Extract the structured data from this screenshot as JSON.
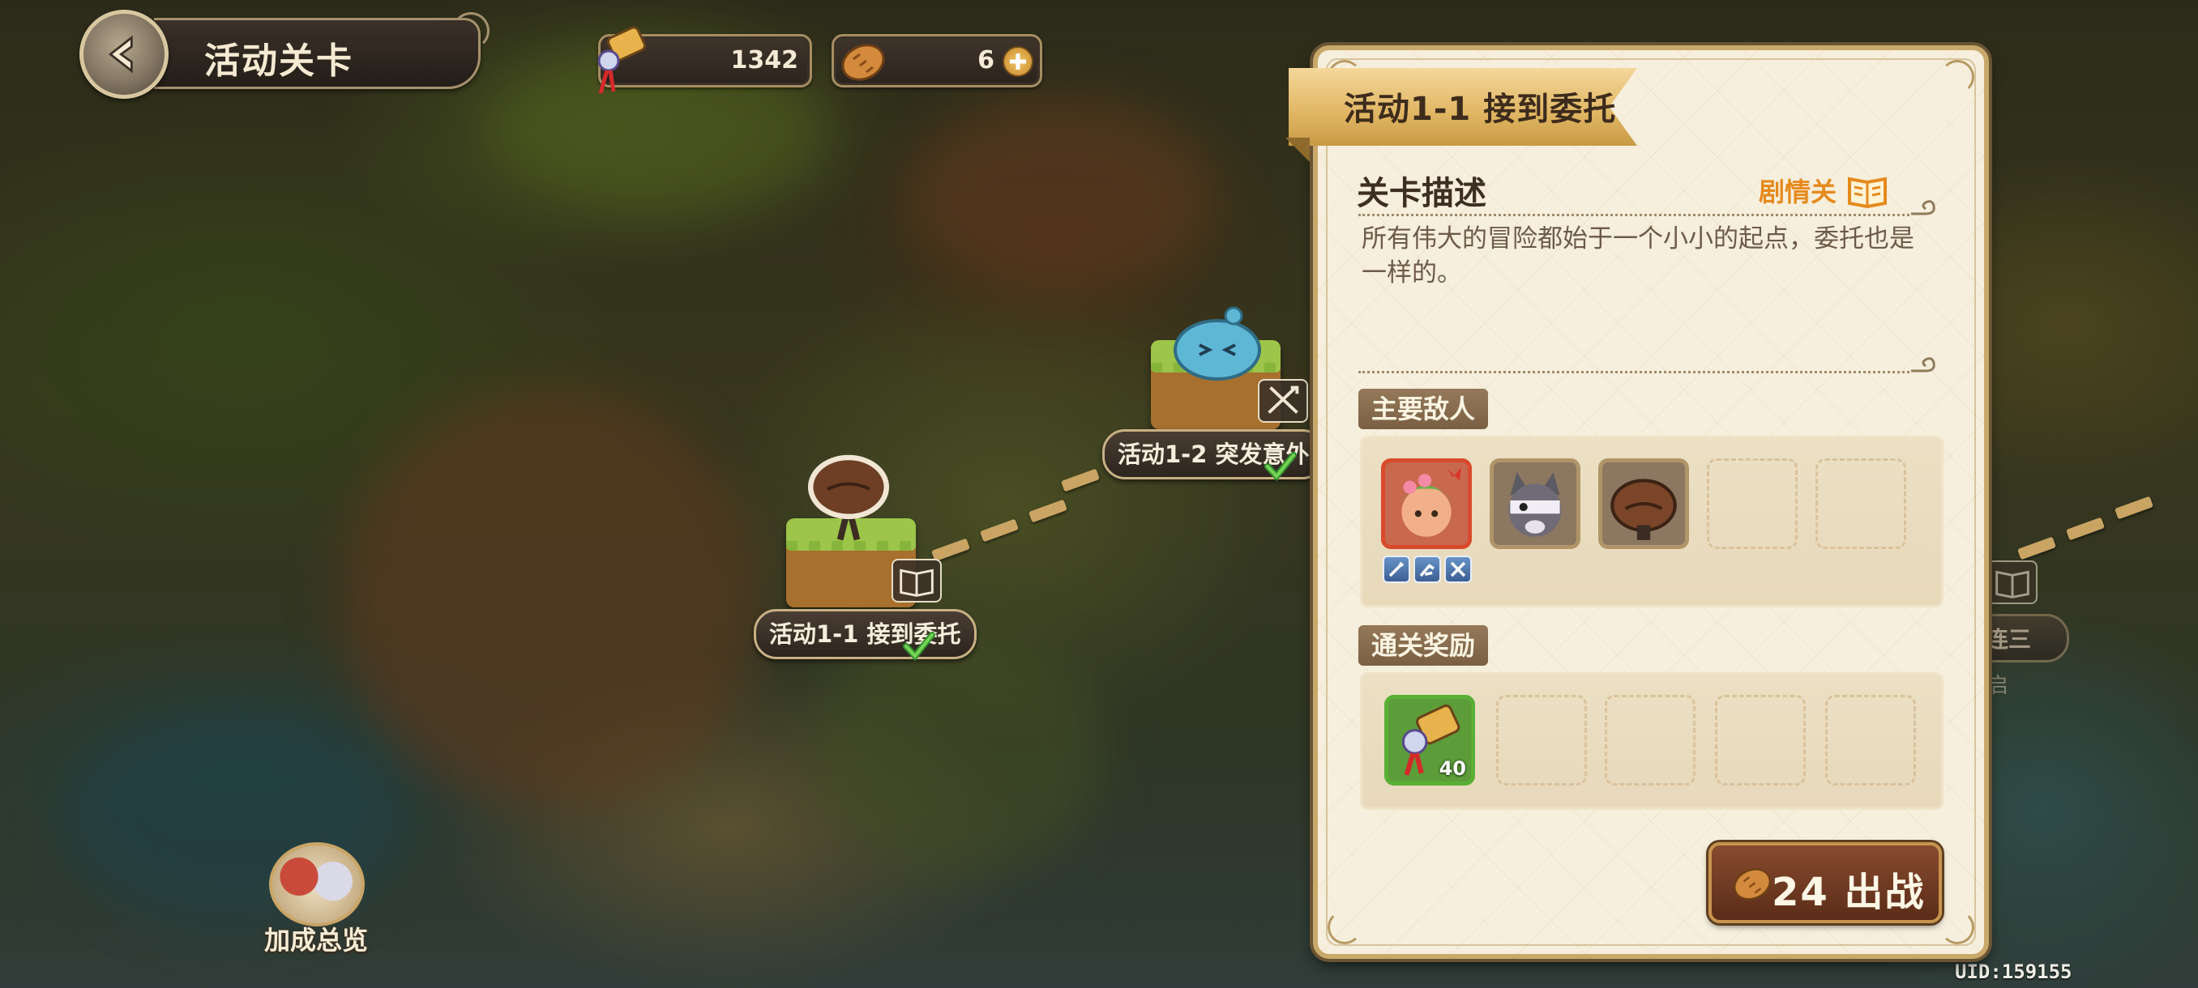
{
  "header": {
    "title": "活动关卡"
  },
  "resources": {
    "hammer_count": "1342",
    "bread_count": "6"
  },
  "map": {
    "nodes": [
      {
        "label": "活动1-1  接到委托",
        "type": "story",
        "cleared": true
      },
      {
        "label": "活动1-2  突发意外",
        "type": "battle",
        "cleared": true
      },
      {
        "label": "连三",
        "type": "story",
        "cleared": false,
        "sub": "启"
      }
    ]
  },
  "bonus": {
    "label": "加成总览"
  },
  "uid": "UID:159155",
  "panel": {
    "stage_title": "活动1-1  接到委托",
    "description_title": "关卡描述",
    "stage_type": "剧情关",
    "description": "所有伟大的冒险都始于一个小小的起点，委托也是一样的。",
    "enemies_title": "主要敌人",
    "enemies": [
      "dryad-girl-boss-icon",
      "masked-raccoon-icon",
      "mushroom-icon"
    ],
    "rewards_title": "通关奖励",
    "rewards": [
      {
        "icon": "hammer-scroll-icon",
        "count": "40"
      }
    ],
    "fight": {
      "cost": "24",
      "label": "出战"
    }
  },
  "colors": {
    "accent_orange": "#e58a1c",
    "panel_bg": "#f7efdd",
    "button_brown": "#6b3a22",
    "reward_green": "#58b034",
    "boss_red": "#d94a2c"
  }
}
